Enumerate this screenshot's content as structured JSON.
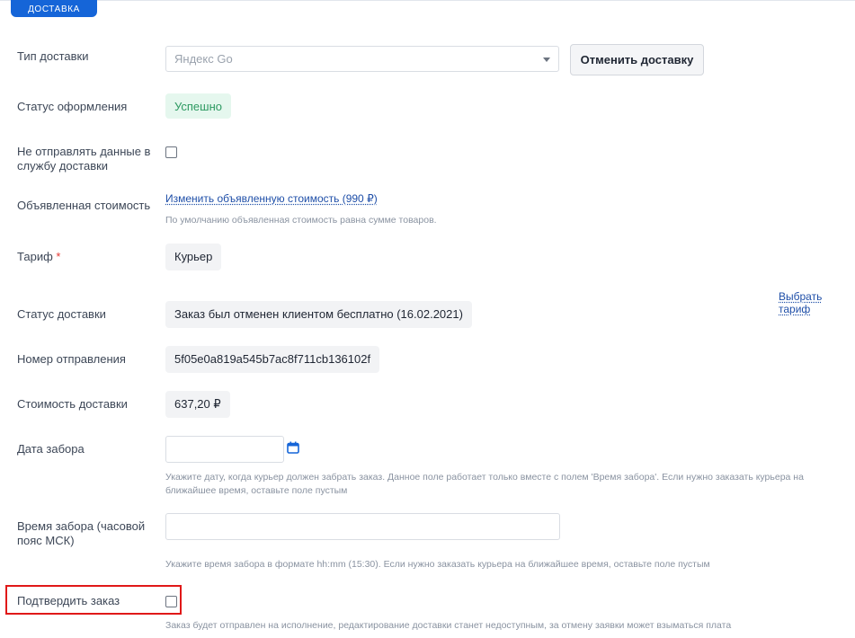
{
  "section": {
    "tab_label": "ДОСТАВКА"
  },
  "delivery_type": {
    "label": "Тип доставки",
    "select_value": "Яндекс Go",
    "cancel_button": "Отменить доставку"
  },
  "registration_status": {
    "label": "Статус оформления",
    "value": "Успешно"
  },
  "no_send": {
    "label_line1": "Не отправлять данные в",
    "label_line2": "службу доставки",
    "checked": false
  },
  "declared_value": {
    "label": "Объявленная стоимость",
    "link": "Изменить объявленную стоимость (990 ₽)",
    "hint": "По умолчанию объявленная стоимость равна сумме товаров."
  },
  "tariff": {
    "label": "Тариф",
    "required_mark": "*",
    "value": "Курьер",
    "choose_link": "Выбрать тариф"
  },
  "delivery_status": {
    "label": "Статус доставки",
    "value": "Заказ был отменен клиентом бесплатно (16.02.2021)"
  },
  "tracking_number": {
    "label": "Номер отправления",
    "value": "5f05e0a819a545b7ac8f711cb136102f"
  },
  "delivery_cost": {
    "label": "Стоимость доставки",
    "value": "637,20 ₽"
  },
  "pickup_date": {
    "label": "Дата забора",
    "value": "",
    "hint_line1": "Укажите дату, когда курьер должен забрать заказ. Данное поле работает только вместе с полем 'Время забора'. Если нужно заказать курьера на",
    "hint_line2": "ближайшее время, оставьте поле пустым"
  },
  "pickup_time": {
    "label_line1": "Время забора (часовой",
    "label_line2": "пояс МСК)",
    "value": "",
    "hint": "Укажите время забора в формате hh:mm (15:30). Если нужно заказать курьера на ближайшее время, оставьте поле пустым"
  },
  "confirm_order": {
    "label": "Подтвердить заказ",
    "checked": false,
    "hint": "Заказ будет отправлен на исполнение, редактирование доставки станет недоступным, за отмену заявки может взыматься плата"
  },
  "colors": {
    "accent": "#1565d8",
    "success_bg": "#e5f7ee",
    "success_text": "#2e9a62",
    "highlight": "#e01818"
  }
}
